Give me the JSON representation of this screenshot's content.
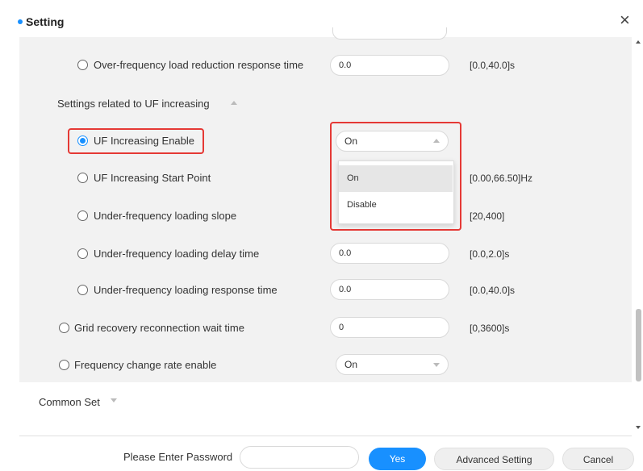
{
  "header": {
    "title": "Setting"
  },
  "rows": {
    "over_freq_response": {
      "label": "Over-frequency load reduction response time",
      "value": "0.0",
      "range": "[0.0,40.0]s"
    },
    "uf_section": {
      "label": "Settings related to UF increasing"
    },
    "uf_enable": {
      "label": "UF Increasing Enable",
      "value": "On"
    },
    "uf_start_point": {
      "label": "UF Increasing Start Point",
      "range": "[0.00,66.50]Hz"
    },
    "uf_loading_slope": {
      "label": "Under-frequency loading slope",
      "range": "[20,400]"
    },
    "uf_loading_delay": {
      "label": "Under-frequency loading delay time",
      "value": "0.0",
      "range": "[0.0,2.0]s"
    },
    "uf_loading_response": {
      "label": "Under-frequency loading response time",
      "value": "0.0",
      "range": "[0.0,40.0]s"
    },
    "grid_recovery": {
      "label": "Grid recovery reconnection wait time",
      "value": "0",
      "range": "[0,3600]s"
    },
    "freq_change_rate": {
      "label": "Frequency change rate enable",
      "value": "On"
    }
  },
  "dropdown": {
    "options": [
      "On",
      "Disable"
    ],
    "selected": "On"
  },
  "common_set": {
    "label": "Common Set"
  },
  "footer": {
    "password_label": "Please Enter Password",
    "password_value": "",
    "yes_label": "Yes",
    "advanced_label": "Advanced Setting",
    "cancel_label": "Cancel"
  },
  "colors": {
    "accent": "#1890ff",
    "highlight": "#e53935"
  },
  "icons": {
    "close": "close-icon",
    "collapse": "caret-up-icon",
    "expand": "caret-down-icon"
  }
}
